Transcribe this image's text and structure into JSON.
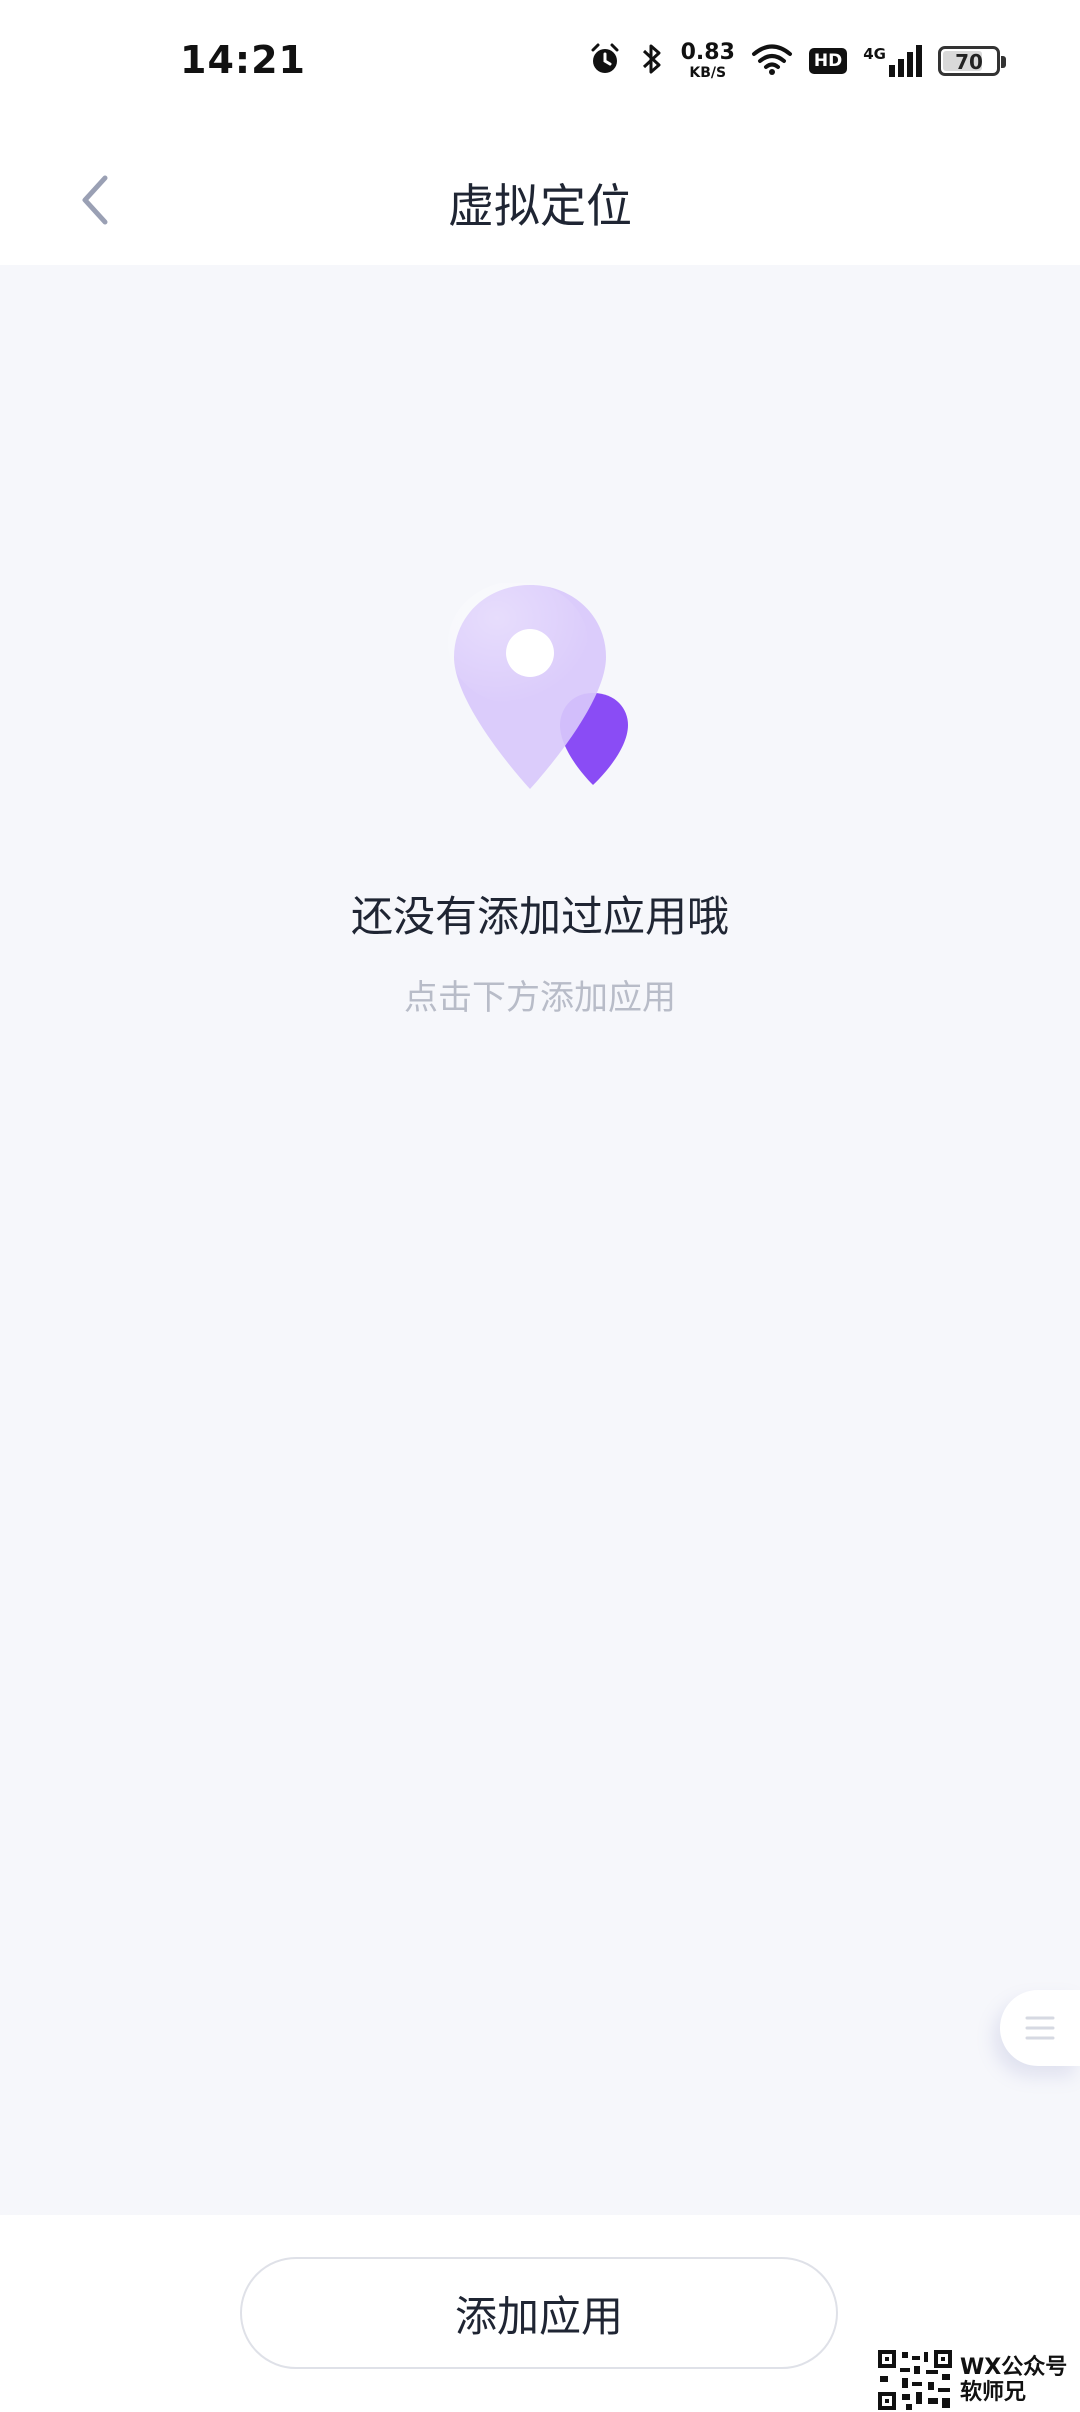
{
  "status_bar": {
    "time": "14:21",
    "net_speed_value": "0.83",
    "net_speed_unit": "KB/S",
    "hd_badge": "HD",
    "network_type": "4G",
    "battery_level": "70",
    "icons": [
      "alarm-icon",
      "bluetooth-icon",
      "wifi-icon",
      "signal-icon",
      "battery-icon"
    ]
  },
  "header": {
    "title": "虚拟定位",
    "back_icon": "chevron-left-icon"
  },
  "empty_state": {
    "illustration_icon": "location-pin-icon",
    "title": "还没有添加过应用哦",
    "hint": "点击下方添加应用"
  },
  "floating_tab": {
    "icon": "menu-lines-icon"
  },
  "footer": {
    "add_app_label": "添加应用"
  },
  "watermark": {
    "line1": "WX公众号",
    "line2": "软师兄"
  },
  "colors": {
    "accent_purple": "#8a4cf5",
    "pin_light": "#d8c8fb",
    "background": "#f6f7fb",
    "hint_text": "#b8bcc8"
  }
}
